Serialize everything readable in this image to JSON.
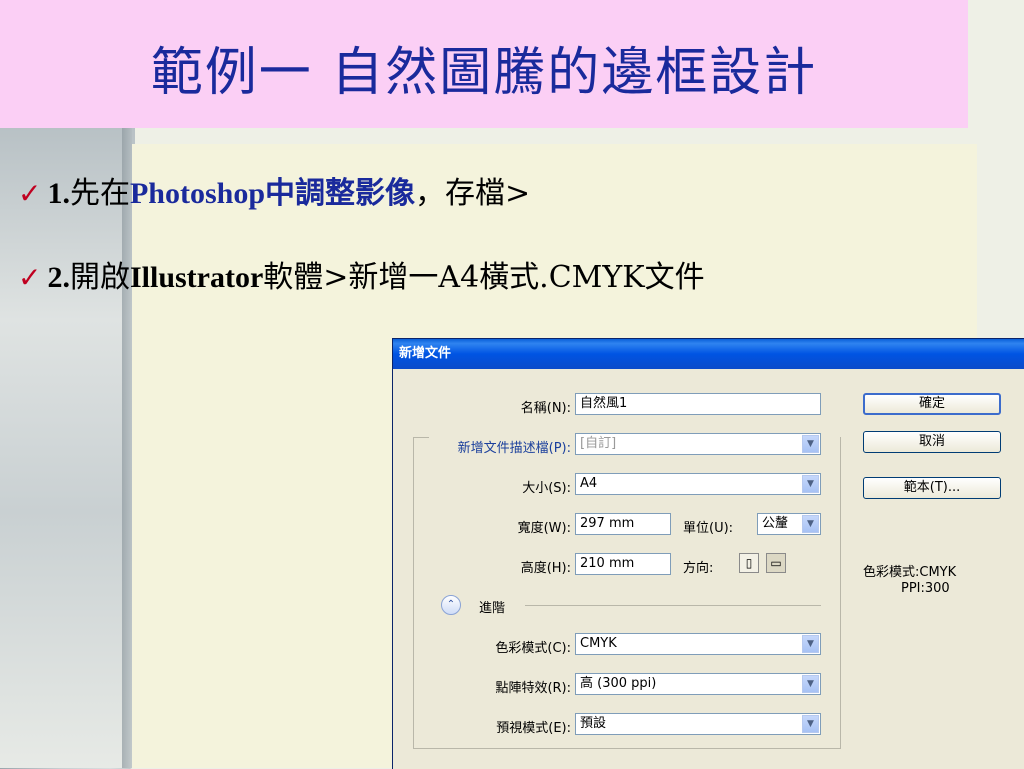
{
  "slide": {
    "title": "範例一 自然圖騰的邊框設計",
    "bullets": [
      {
        "check": "✓",
        "num": "1.",
        "pre": "先在",
        "hl": "Photoshop中調整影像",
        "post": "，存檔>"
      },
      {
        "check": "✓",
        "num": "2.",
        "pre": "開啟",
        "app": "Illustrator",
        "post": "軟體>新增一A4橫式.CMYK文件"
      }
    ]
  },
  "dialog": {
    "title": "新增文件",
    "name_label": "名稱(N):",
    "name_value": "自然風1",
    "profile_label": "新增文件描述檔(P):",
    "profile_value": "[自訂]",
    "size_label": "大小(S):",
    "size_value": "A4",
    "width_label": "寬度(W):",
    "width_value": "297 mm",
    "units_label": "單位(U):",
    "units_value": "公釐",
    "height_label": "高度(H):",
    "height_value": "210 mm",
    "orientation_label": "方向:",
    "advanced_label": "進階",
    "color_mode_label": "色彩模式(C):",
    "color_mode_value": "CMYK",
    "raster_label": "點陣特效(R):",
    "raster_value": "高 (300 ppi)",
    "preview_label": "預視模式(E):",
    "preview_value": "預設",
    "ok_button": "確定",
    "cancel_button": "取消",
    "template_button": "範本(T)...",
    "info_color_mode": "色彩模式:CMYK",
    "info_ppi": "PPI:300"
  }
}
